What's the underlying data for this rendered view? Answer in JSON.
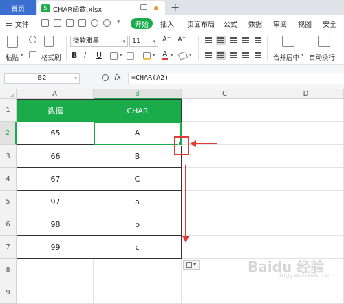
{
  "tabs": {
    "home_label": "首页",
    "file_label": "CHAR函数.xlsx",
    "file_icon": "S",
    "add_label": "+"
  },
  "menu": {
    "file_label": "文件",
    "start_label": "开始",
    "items": [
      "插入",
      "页面布局",
      "公式",
      "数据",
      "审阅",
      "视图",
      "安全"
    ]
  },
  "ribbon": {
    "paste_label": "粘贴",
    "format_painter_label": "格式刷",
    "font_name": "微软雅黑",
    "font_size": "11",
    "merge_label": "合并居中",
    "wrap_label": "自动换行",
    "bold": "B",
    "italic": "I",
    "underline": "U",
    "grow_font": "A⁺",
    "shrink_font": "A⁻",
    "font_color_glyph": "A"
  },
  "formula_bar": {
    "name_box": "B2",
    "fx_label": "fx",
    "formula": "=CHAR(A2)"
  },
  "sheet": {
    "columns": [
      "A",
      "B",
      "C",
      "D"
    ],
    "rows": [
      "1",
      "2",
      "3",
      "4",
      "5",
      "6",
      "7",
      "8",
      "9"
    ],
    "header": {
      "a": "数据",
      "b": "CHAR"
    },
    "data": [
      {
        "a": "65",
        "b": "A"
      },
      {
        "a": "66",
        "b": "B"
      },
      {
        "a": "67",
        "b": "C"
      },
      {
        "a": "97",
        "b": "a"
      },
      {
        "a": "98",
        "b": "b"
      },
      {
        "a": "99",
        "b": "c"
      }
    ],
    "selected_cell": "B2",
    "paste_options_glyph": "▾"
  },
  "colors": {
    "accent": "#1aab4b",
    "tab_active": "#3a6fd0",
    "annotation": "#e53935"
  }
}
